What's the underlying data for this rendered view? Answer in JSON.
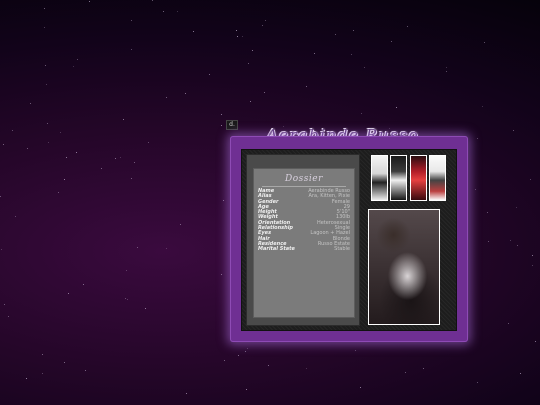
{
  "page": {
    "title": "Aerabinde Russo",
    "favicon_label": "d."
  },
  "dossier": {
    "title": "Dossier",
    "rows": [
      {
        "label": "Name",
        "value": "Aerabinde Russo"
      },
      {
        "label": "Alias",
        "value": "Ara, Kitten, Pixie"
      },
      {
        "label": "Gender",
        "value": "Female"
      },
      {
        "label": "Age",
        "value": "29"
      },
      {
        "label": "Height",
        "value": "5'10\""
      },
      {
        "label": "Weight",
        "value": "130lb"
      },
      {
        "label": "Orientation",
        "value": "Heterosexual"
      },
      {
        "label": "Relationship",
        "value": "Single"
      },
      {
        "label": "Eyes",
        "value": "Lagoon + Hazel"
      },
      {
        "label": "Hair",
        "value": "Blonde"
      },
      {
        "label": "Residence",
        "value": "Russo Estate"
      },
      {
        "label": "Marital State",
        "value": "Stable"
      }
    ]
  },
  "gallery": {
    "thumbnails": [
      "thumbnail-1",
      "thumbnail-2",
      "thumbnail-3",
      "thumbnail-4"
    ],
    "main_photo": "portrait-photo"
  },
  "colors": {
    "frame": "#6f2f93",
    "background": "#240628",
    "panel": "#7b7b7b"
  }
}
